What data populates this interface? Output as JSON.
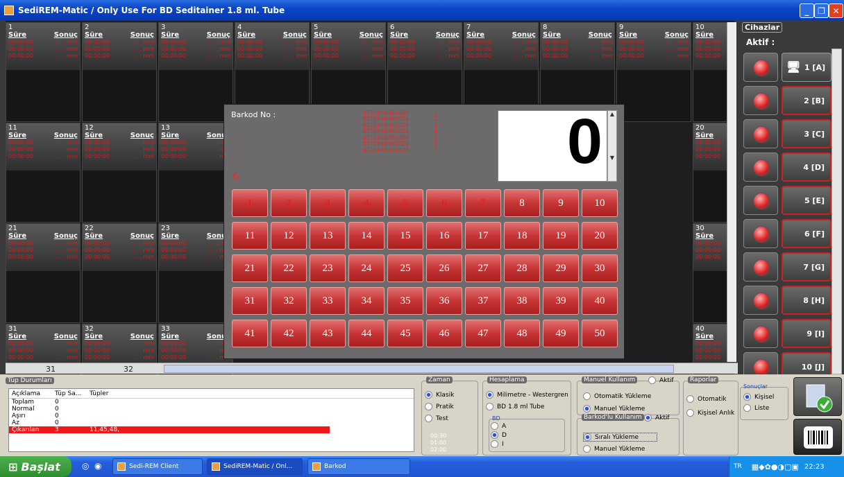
{
  "window": {
    "title": "SediREM-Matic  /  Only Use For BD Seditainer 1.8 ml. Tube"
  },
  "cell_labels": {
    "sure": "Süre",
    "sonuc": "Sonuç",
    "time": "00:00:00",
    "mm": ". . . mm"
  },
  "cells_row1": [
    "1",
    "2",
    "3",
    "4",
    "5",
    "6",
    "7",
    "8",
    "9",
    "10"
  ],
  "cells_row2": [
    "11",
    "12",
    "13",
    "20"
  ],
  "cells_row3": [
    "21",
    "22",
    "23",
    "30"
  ],
  "cells_row4": [
    "31",
    "32",
    "33",
    "40"
  ],
  "hscroll": {
    "n1": "31",
    "n2": "32"
  },
  "popup": {
    "barkod_label": "Barkod No :",
    "barcodes": [
      "8715946360324",
      "8715946360324",
      "8715946360324",
      "8715946360324",
      "8715946360324",
      "8715946360324",
      "8715946360324"
    ],
    "barcode_indices": [
      "1",
      "2",
      "3",
      "4",
      "5",
      "6",
      "7"
    ],
    "big_number": "0",
    "current": "6",
    "done_buttons": [
      1,
      2,
      3,
      4,
      5,
      6,
      7
    ],
    "buttons": [
      "1",
      "2",
      "3",
      "4",
      "5",
      "6",
      "7",
      "8",
      "9",
      "10",
      "11",
      "12",
      "13",
      "14",
      "15",
      "16",
      "17",
      "18",
      "19",
      "20",
      "21",
      "22",
      "23",
      "24",
      "25",
      "26",
      "27",
      "28",
      "29",
      "30",
      "31",
      "32",
      "33",
      "34",
      "35",
      "36",
      "37",
      "38",
      "39",
      "40",
      "41",
      "42",
      "43",
      "44",
      "45",
      "46",
      "47",
      "48",
      "49",
      "50"
    ]
  },
  "side": {
    "title": "Cihazlar",
    "aktif": "Aktif :",
    "devices": [
      "1 [A]",
      "2 [B]",
      "3 [C]",
      "4 [D]",
      "5 [E]",
      "6 [F]",
      "7 [G]",
      "8 [H]",
      "9 [I]",
      "10 [J]"
    ]
  },
  "tup": {
    "title": "Tüp Durumları",
    "headers": [
      "Açıklama",
      "Tüp Sa...",
      "Tüpler"
    ],
    "rows": [
      {
        "a": "Toplam",
        "b": "0",
        "c": ""
      },
      {
        "a": "Normal",
        "b": "0",
        "c": ""
      },
      {
        "a": "Aşırı",
        "b": "0",
        "c": ""
      },
      {
        "a": "Az",
        "b": "0",
        "c": ""
      },
      {
        "a": "Çıkarılan",
        "b": "3",
        "c": "11,45,48,"
      }
    ]
  },
  "zaman": {
    "title": "Zaman",
    "opts": [
      "Klasik",
      "Pratik",
      "Test"
    ],
    "times": [
      "00:30",
      "01:00",
      "02:00"
    ]
  },
  "hesaplama": {
    "title": "Hesaplama",
    "opts": [
      "Milimetre - Westergren",
      "BD 1.8 ml Tube"
    ],
    "bd": "BD",
    "bd_opts": [
      "A",
      "D",
      "I"
    ]
  },
  "manuel": {
    "title": "Manuel Kullanım",
    "aktif": "Aktif",
    "opts": [
      "Otomatik Yükleme",
      "Manuel Yükleme"
    ]
  },
  "barkodlu": {
    "title": "Barkod'lu Kullanım",
    "aktif": "Aktif",
    "opts": [
      "Sıralı Yükleme",
      "Manuel Yükleme"
    ]
  },
  "raporlar": {
    "title": "Raporlar",
    "opts": [
      "Otomatik",
      "Kişisel Anlık"
    ]
  },
  "sonuclar": {
    "title": "Sonuçlar",
    "opts": [
      "Kişisel",
      "Liste"
    ]
  },
  "taskbar": {
    "start": "Başlat",
    "items": [
      "Sedi-REM Client",
      "SediREM-Matic  /  Onl...",
      "Barkod"
    ],
    "lang": "TR",
    "time": "22:23"
  }
}
